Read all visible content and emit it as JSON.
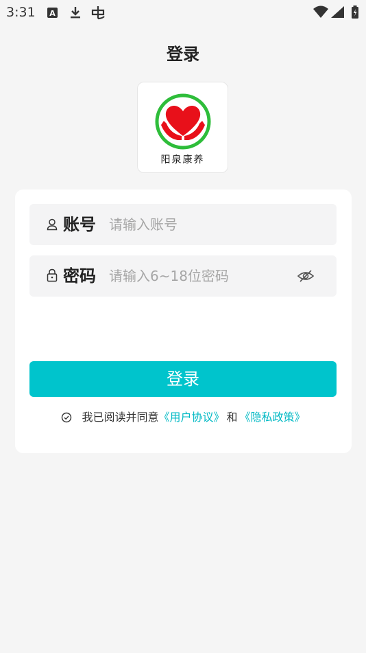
{
  "status_bar": {
    "time": "3:31",
    "icons": [
      "notification-a-icon",
      "download-icon",
      "bug-icon",
      "wifi-icon",
      "cell-signal-icon",
      "battery-charging-icon"
    ]
  },
  "header": {
    "title": "登录"
  },
  "logo": {
    "text": "阳泉康养",
    "icon": "heart-in-hands-logo",
    "colors": {
      "ring": "#2ebd3a",
      "heart": "#e8101a"
    }
  },
  "form": {
    "account": {
      "label": "账号",
      "placeholder": "请输入账号",
      "value": "",
      "icon": "user-icon"
    },
    "password": {
      "label": "密码",
      "placeholder": "请输入6~18位密码",
      "value": "",
      "icon": "lock-icon",
      "toggle_icon": "eye-off-icon"
    },
    "login_button": "登录",
    "agreement": {
      "prefix": "我已阅读并同意",
      "user_agreement": "《用户协议》",
      "conjunction": "和",
      "privacy_policy": "《隐私政策》"
    }
  },
  "colors": {
    "accent": "#00c4cc",
    "link": "#00b9c4",
    "background": "#f5f5f5",
    "field_bg": "#f4f4f5"
  }
}
